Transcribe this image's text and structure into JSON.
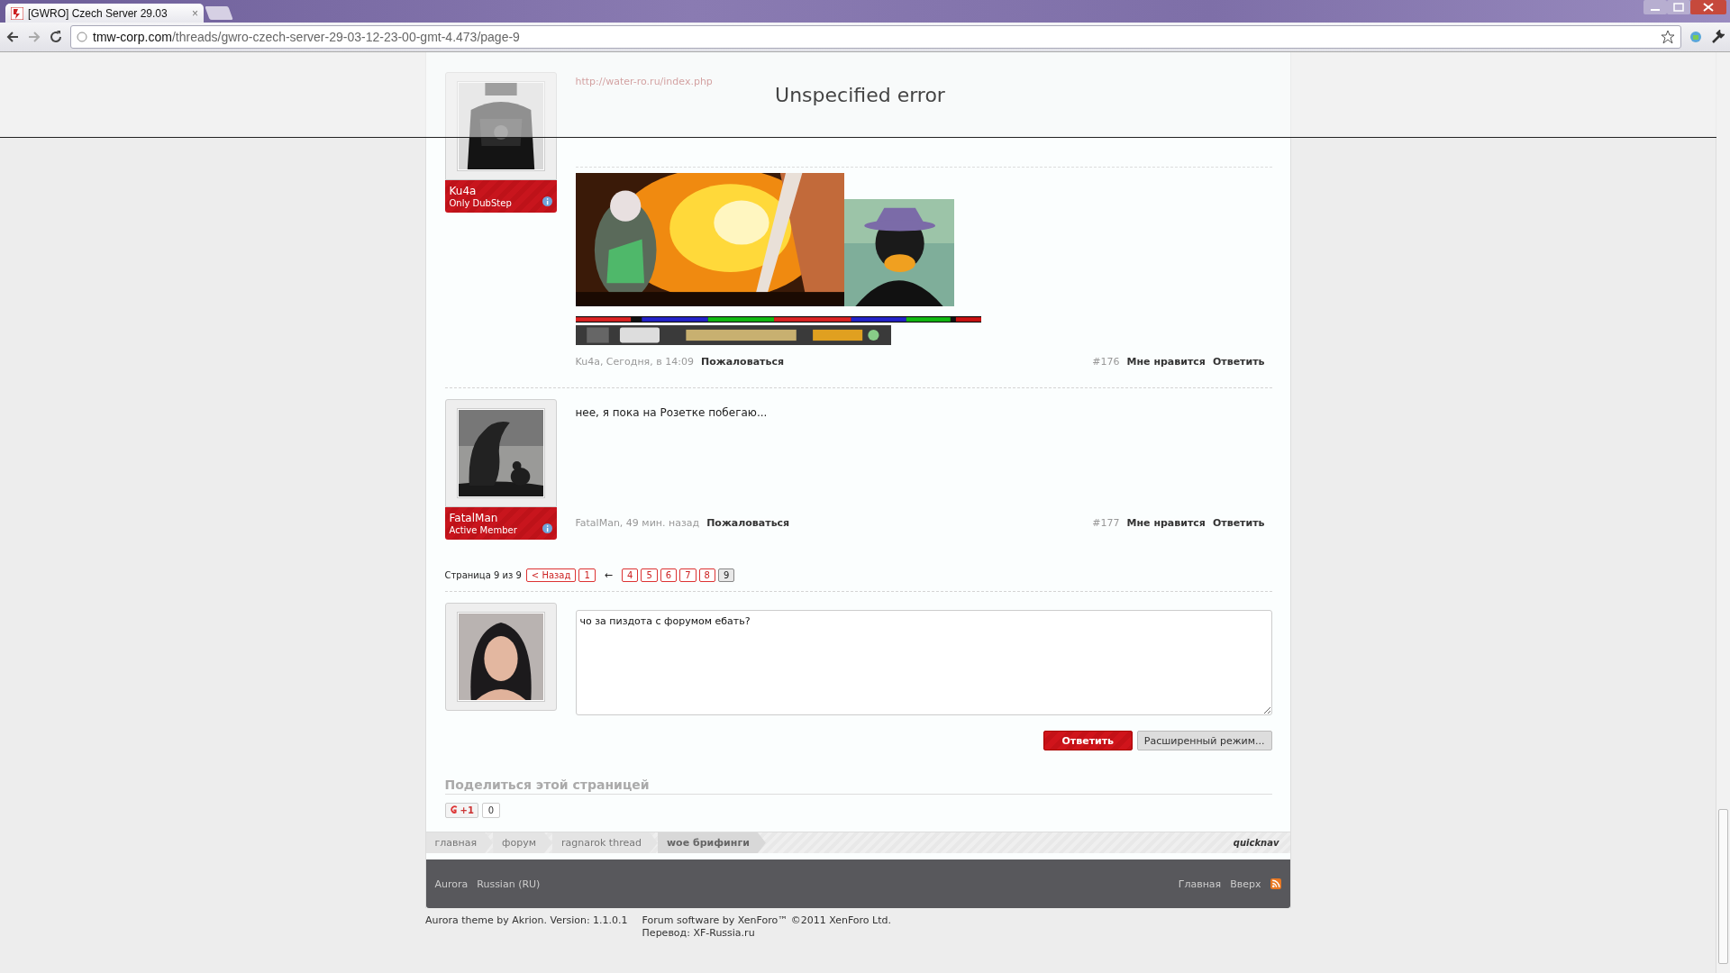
{
  "browser": {
    "tabs": [
      {
        "title": "[GWRO] Czech Server 29.03",
        "close": "×",
        "selected": true
      }
    ],
    "address": {
      "host": "tmw-corp.com",
      "path": "/threads/gwro-czech-server-29-03-12-23-00-gmt-4.473/page-9"
    }
  },
  "error_banner": {
    "message": "Unspecified error"
  },
  "posts": [
    {
      "user": "Ku4a",
      "user_title": "Only DubStep",
      "link": "http://water-ro.ru/index.php",
      "has_signature": true,
      "meta": "Ku4a, Сегодня, в 14:09",
      "report": "Пожаловаться",
      "number": "#176",
      "like": "Мне нравится",
      "reply": "Ответить"
    },
    {
      "user": "FatalMan",
      "user_title": "Active Member",
      "message": "нее, я пока на Розетке побегаю...",
      "has_signature": false,
      "meta": "FatalMan, 49 мин. назад",
      "report": "Пожаловаться",
      "number": "#177",
      "like": "Мне нравится",
      "reply": "Ответить"
    }
  ],
  "pagination": {
    "label": "Страница 9 из 9",
    "prev": "< Назад",
    "items": [
      {
        "kind": "page",
        "label": "1",
        "selected": false
      },
      {
        "kind": "gap",
        "label": "←"
      },
      {
        "kind": "page",
        "label": "4",
        "selected": false
      },
      {
        "kind": "page",
        "label": "5",
        "selected": false
      },
      {
        "kind": "page",
        "label": "6",
        "selected": false
      },
      {
        "kind": "page",
        "label": "7",
        "selected": false
      },
      {
        "kind": "page",
        "label": "8",
        "selected": false
      },
      {
        "kind": "page",
        "label": "9",
        "selected": true
      }
    ]
  },
  "reply": {
    "text": "чо за пиздота с форумом ебать?",
    "submit": "Ответить",
    "advanced": "Расширенный режим..."
  },
  "share": {
    "heading": "Поделиться этой страницей",
    "plus_one": "+1",
    "count": "0"
  },
  "breadcrumbs": [
    {
      "label": "главная",
      "selected": false
    },
    {
      "label": "форум",
      "selected": false
    },
    {
      "label": "ragnarok thread",
      "selected": false
    },
    {
      "label": "woe брифинги",
      "selected": true
    }
  ],
  "quicknav": "quicknav",
  "footer": {
    "links_left": [
      "Aurora",
      "Russian (RU)"
    ],
    "links_right": [
      "Главная",
      "Вверх"
    ],
    "theme_credit": "Aurora theme by Akrion. Version: 1.1.0.1",
    "software_credit": "Forum software by XenForo™ ©2011 XenForo Ltd.",
    "translation": "Перевод: XF-Russia.ru"
  }
}
